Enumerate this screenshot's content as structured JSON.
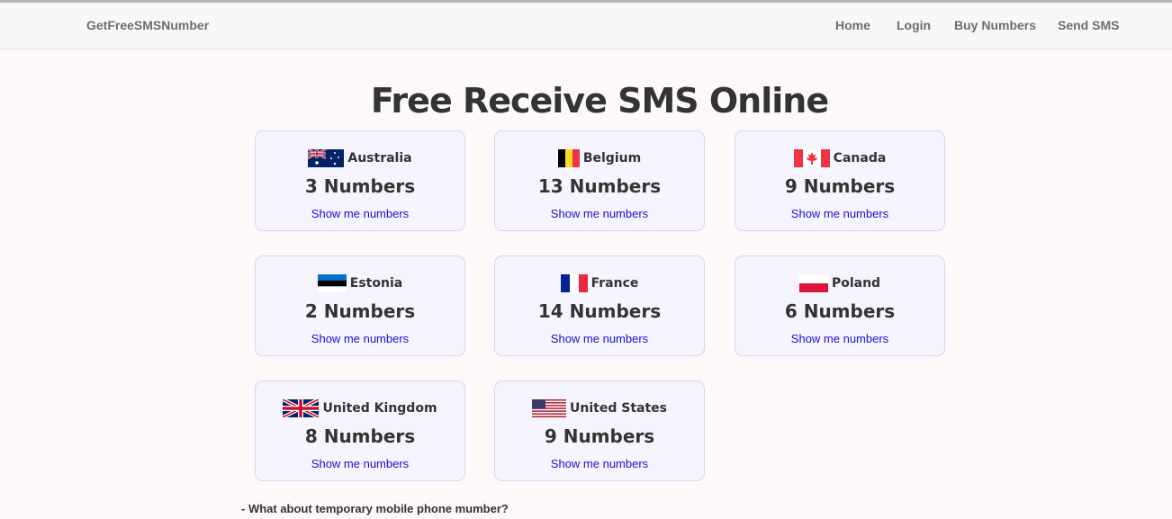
{
  "nav": {
    "brand": "GetFreeSMSNumber",
    "links": [
      "Home",
      "Login",
      "Buy Numbers",
      "Send SMS"
    ]
  },
  "title": "Free Receive SMS Online",
  "cards": [
    {
      "country": "Australia",
      "count": "3 Numbers",
      "link": "Show me numbers",
      "flag": "australia-flag-icon"
    },
    {
      "country": "Belgium",
      "count": "13 Numbers",
      "link": "Show me numbers",
      "flag": "belgium-flag-icon"
    },
    {
      "country": "Canada",
      "count": "9 Numbers",
      "link": "Show me numbers",
      "flag": "canada-flag-icon"
    },
    {
      "country": "Estonia",
      "count": "2 Numbers",
      "link": "Show me numbers",
      "flag": "estonia-flag-icon"
    },
    {
      "country": "France",
      "count": "14 Numbers",
      "link": "Show me numbers",
      "flag": "france-flag-icon"
    },
    {
      "country": "Poland",
      "count": "6 Numbers",
      "link": "Show me numbers",
      "flag": "poland-flag-icon"
    },
    {
      "country": "United Kingdom",
      "count": "8 Numbers",
      "link": "Show me numbers",
      "flag": "united-kingdom-flag-icon"
    },
    {
      "country": "United States",
      "count": "9 Numbers",
      "link": "Show me numbers",
      "flag": "united-states-flag-icon"
    }
  ],
  "faq_question": "- What about temporary mobile phone mumber?",
  "colors": {
    "link": "#1a0dd6",
    "card_background": "#f6f5ff",
    "card_border": "#d9d2f5",
    "page_background": "#fdf9f8"
  }
}
